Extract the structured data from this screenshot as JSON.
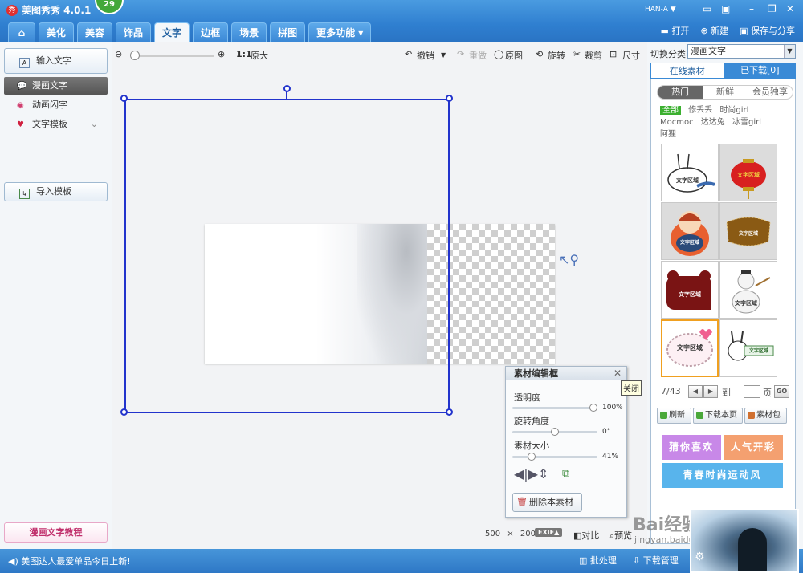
{
  "window": {
    "logo_glyph": "秀",
    "title": "美图秀秀 4.0.1",
    "badge": "29",
    "user": "HAN-A ▼"
  },
  "tabs": [
    {
      "label": "⌂"
    },
    {
      "label": "美化"
    },
    {
      "label": "美容"
    },
    {
      "label": "饰品"
    },
    {
      "label": "文字"
    },
    {
      "label": "边框"
    },
    {
      "label": "场景"
    },
    {
      "label": "拼图"
    },
    {
      "label": "更多功能 ▾"
    }
  ],
  "top_actions": {
    "open": "打开",
    "new": "新建",
    "save_share": "保存与分享"
  },
  "left": {
    "input_text": "输入文字",
    "items": [
      {
        "label": "漫画文字",
        "icon": "comic-bubble-icon"
      },
      {
        "label": "动画闪字",
        "icon": "animated-text-icon"
      },
      {
        "label": "文字模板",
        "icon": "text-template-icon"
      }
    ],
    "import_template": "导入模板",
    "tutorial": "漫画文字教程"
  },
  "toolbar": {
    "zoom_1to1": "1:1",
    "original_size": "原大",
    "undo": "撤销",
    "redo": "重做",
    "original": "原图",
    "rotate": "旋转",
    "crop": "裁剪",
    "size": "尺寸"
  },
  "canvas": {
    "width": "500",
    "times": "×",
    "height": "200",
    "exif": "EXIF▲",
    "compare": "对比",
    "preview": "预览"
  },
  "editor": {
    "title": "素材编辑框",
    "close_tooltip": "关闭",
    "opacity_label": "透明度",
    "opacity_value": "100%",
    "opacity_fraction": 1.0,
    "rotation_label": "旋转角度",
    "rotation_value": "0°",
    "rotation_fraction": 0.5,
    "size_label": "素材大小",
    "size_value": "41%",
    "size_fraction": 0.2,
    "delete_label": "删除本素材"
  },
  "right": {
    "category_label": "切换分类",
    "category_value": "漫画文字",
    "source_tabs": [
      "在线素材",
      "已下载[0]"
    ],
    "sub_tabs": [
      "热门",
      "新鲜",
      "会员独享"
    ],
    "tags": [
      "全部",
      "修丢丢",
      "时尚girl",
      "Mocmoc",
      "达达兔",
      "冰雪girl",
      "阿狸"
    ],
    "grid_label": "文字区域",
    "page_current": "7/43",
    "page_to": "到",
    "page_unit": "页",
    "go": "GO",
    "refresh": "刷新",
    "download_page": "下载本页",
    "pack": "素材包",
    "banner_like": "猜你喜欢",
    "banner_popular": "人气开彩",
    "banner_youth": "青春时尚运动风"
  },
  "status": {
    "message": "美图达人最爱单品今日上新!",
    "batch": "批处理",
    "download_manager": "下载管理"
  },
  "watermark": {
    "text": "Bai经验",
    "url": "jingyan.baidu.com"
  },
  "colors": {
    "accent_blue": "#2f7fd0",
    "selection_blue": "#2233cc",
    "badge_green": "#43a83a",
    "tag_green": "#3cb030",
    "banner_purple": "#c888e8",
    "banner_orange": "#f4a070",
    "banner_blue": "#58b4ec"
  }
}
